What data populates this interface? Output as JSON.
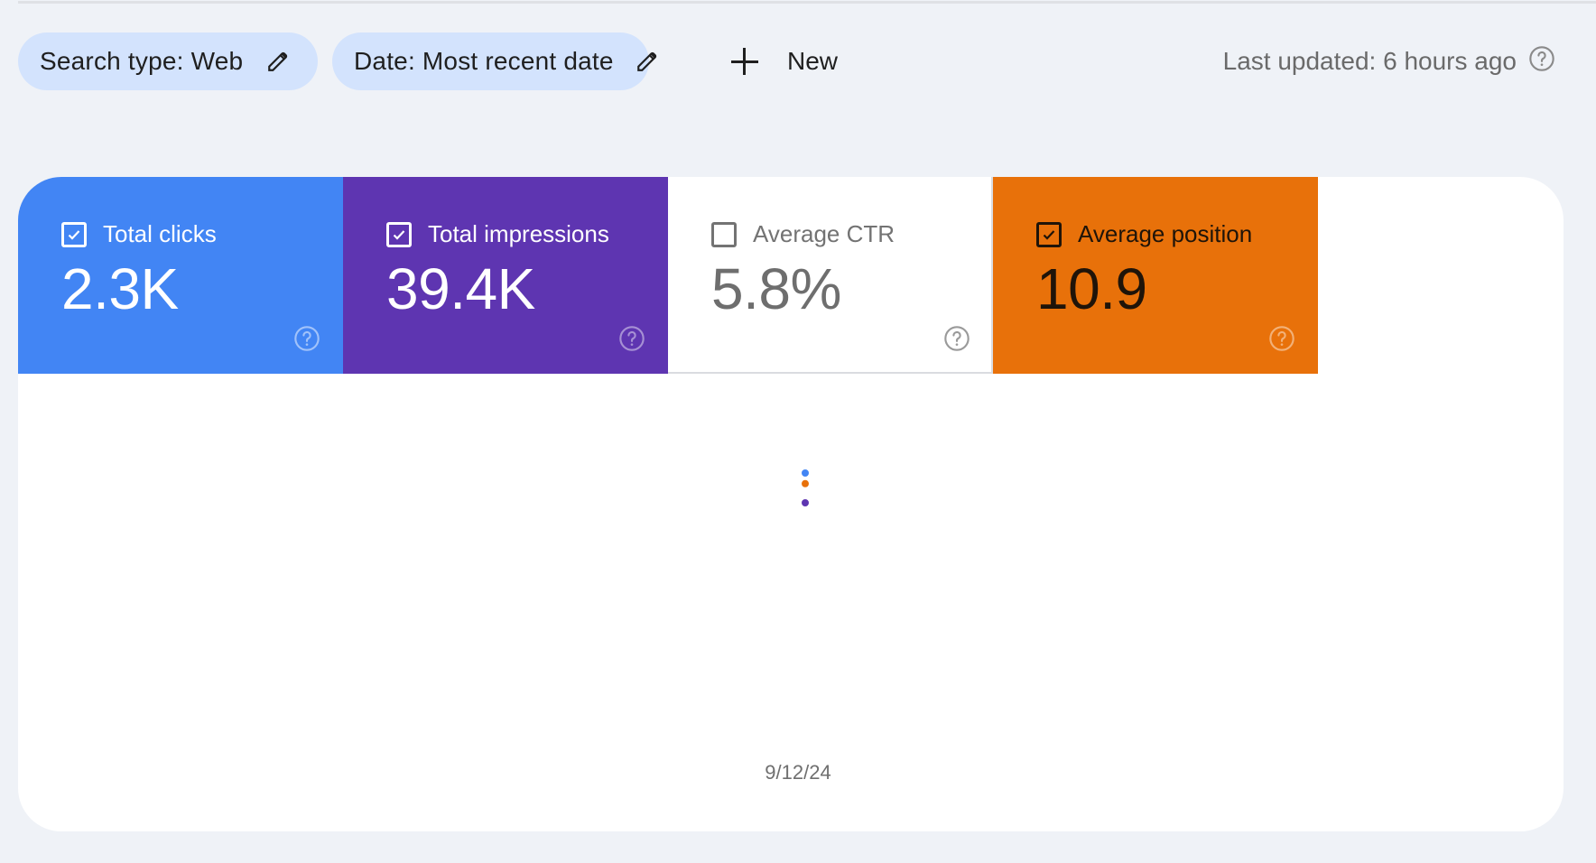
{
  "filters": {
    "search_type": {
      "label": "Search type: Web",
      "icon": "pencil-icon"
    },
    "date": {
      "label": "Date: Most recent date",
      "icon": "pencil-icon"
    },
    "new_button": {
      "label": "New",
      "icon": "plus-icon"
    }
  },
  "last_updated": {
    "text": "Last updated: 6 hours ago",
    "icon": "help-circle-icon"
  },
  "metrics": [
    {
      "id": "clicks",
      "label": "Total clicks",
      "value": "2.3K",
      "checked": true,
      "color": "#4285f4"
    },
    {
      "id": "impressions",
      "label": "Total impressions",
      "value": "39.4K",
      "checked": true,
      "color": "#5e35b1"
    },
    {
      "id": "ctr",
      "label": "Average CTR",
      "value": "5.8%",
      "checked": false,
      "color": "#ffffff"
    },
    {
      "id": "position",
      "label": "Average position",
      "value": "10.9",
      "checked": true,
      "color": "#e8710a"
    }
  ],
  "chart_data": {
    "type": "scatter",
    "title": "",
    "xlabel": "",
    "ylabel": "",
    "x": [
      "9/12/24"
    ],
    "x_tick_labels": [
      "9/12/24"
    ],
    "grid": false,
    "series": [
      {
        "name": "Total clicks",
        "values": [
          2300
        ],
        "color": "#4285f4"
      },
      {
        "name": "Total impressions",
        "values": [
          39400
        ],
        "color": "#5e35b1"
      },
      {
        "name": "Average position",
        "values": [
          10.9
        ],
        "color": "#e8710a"
      }
    ],
    "note": "Each series is drawn on its own independent axis; a single data point per series is shown for the single selected date."
  }
}
